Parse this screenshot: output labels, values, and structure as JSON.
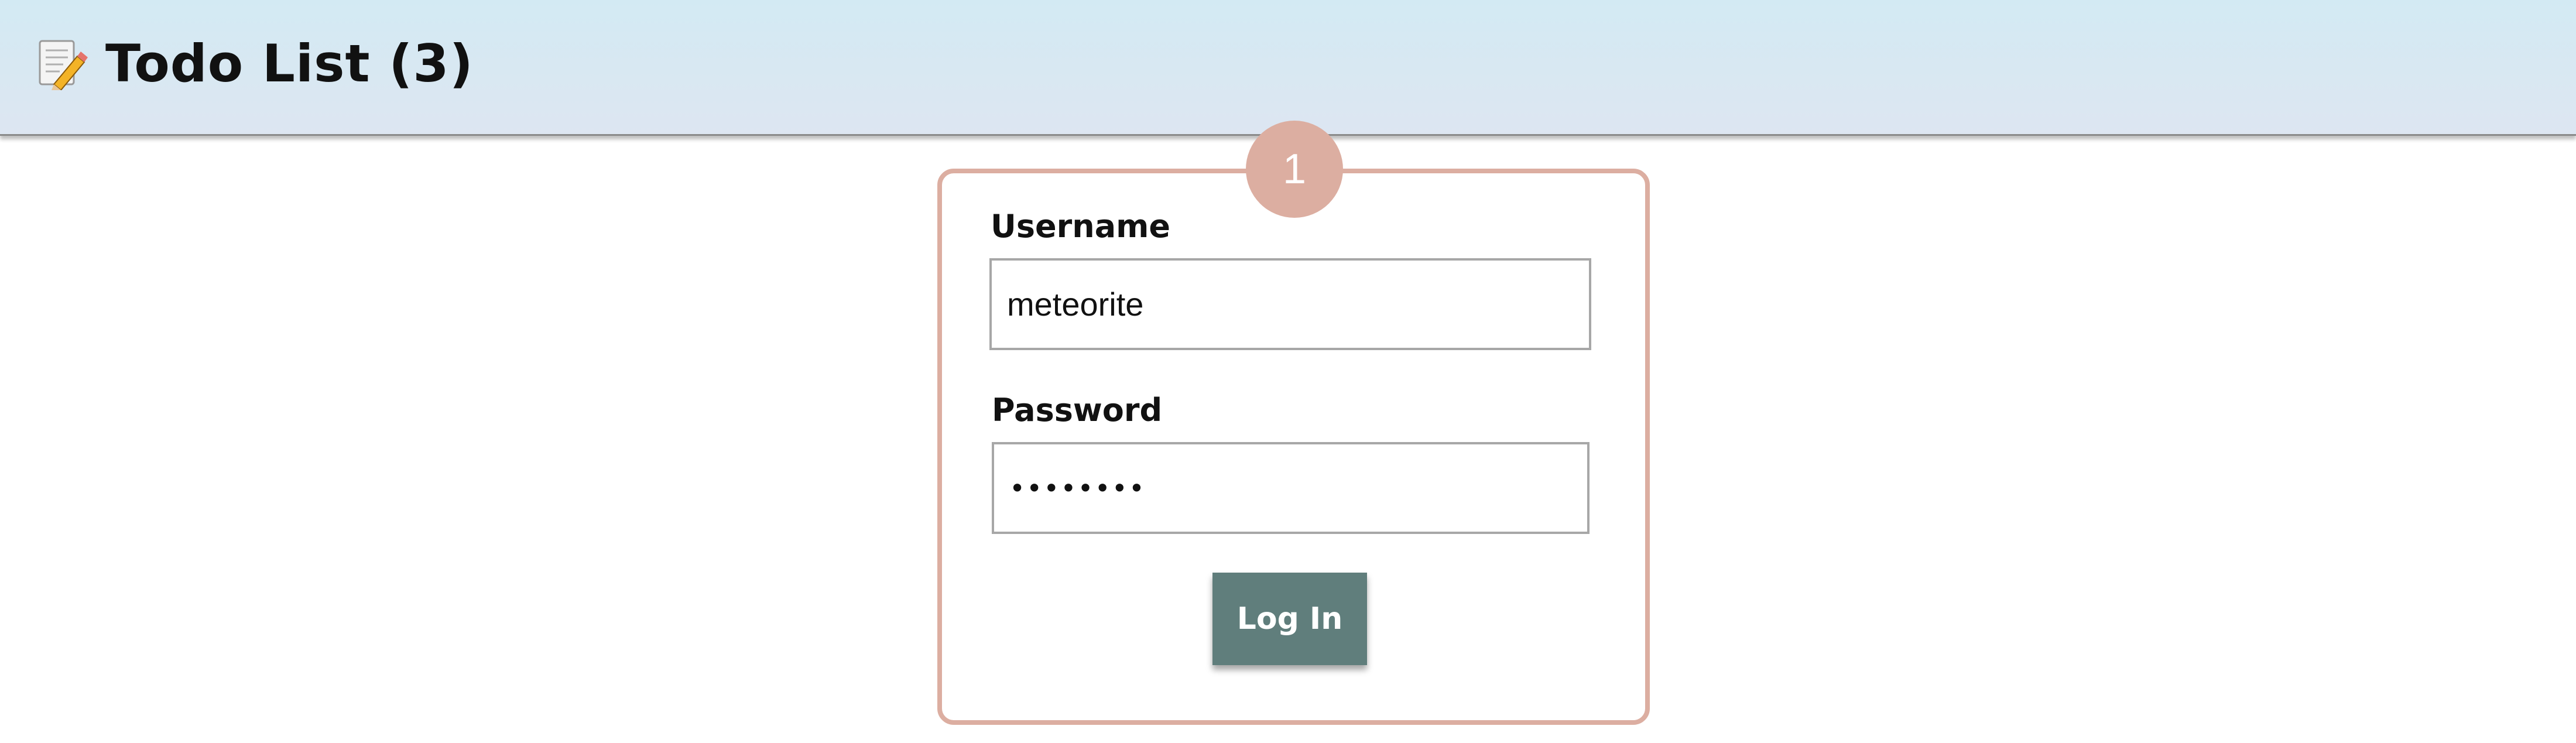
{
  "header": {
    "icon": "memo-pencil-icon",
    "title": "Todo List (3)"
  },
  "step_badge": "1",
  "login": {
    "username_label": "Username",
    "username_value": "meteorite",
    "password_label": "Password",
    "password_value": "••••••••",
    "button_label": "Log In"
  },
  "colors": {
    "header_bg_top": "#d3eaf3",
    "header_bg_bottom": "#dde6f2",
    "card_border": "#dcaea1",
    "badge_bg": "#dcaea1",
    "button_bg": "#607e7c",
    "button_text": "#ffffff"
  }
}
